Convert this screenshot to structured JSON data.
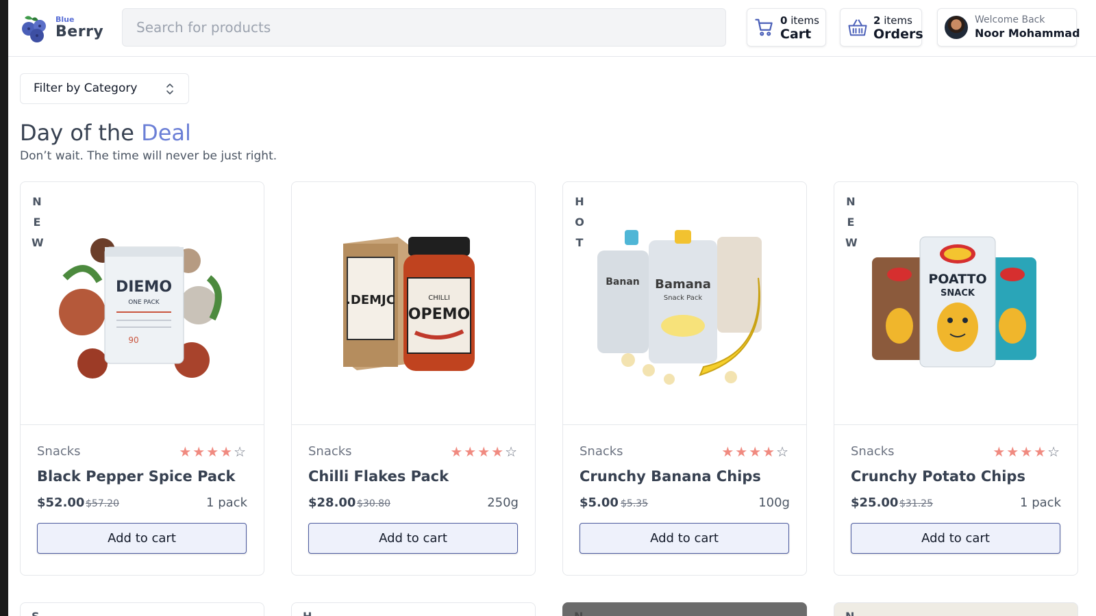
{
  "brand": {
    "small": "Blue",
    "big": "Berry"
  },
  "search": {
    "placeholder": "Search for products"
  },
  "header": {
    "cart": {
      "count": "0",
      "count_suffix": " items",
      "label": "Cart"
    },
    "orders": {
      "count": "2",
      "count_suffix": " items",
      "label": "Orders"
    },
    "user": {
      "greeting": "Welcome Back",
      "name": "Noor Mohammad"
    }
  },
  "filter": {
    "label": "Filter by Category"
  },
  "section": {
    "title_main": "Day of the ",
    "title_accent": "Deal",
    "subtitle": "Don’t wait. The time will never be just right."
  },
  "products": [
    {
      "badge": [
        "N",
        "E",
        "W"
      ],
      "category": "Snacks",
      "name": "Black Pepper Spice Pack",
      "price": "$52.00",
      "old_price": "$57.20",
      "unit": "1 pack",
      "rating": 4,
      "cta": "Add to cart"
    },
    {
      "badge": [],
      "category": "Snacks",
      "name": "Chilli Flakes Pack",
      "price": "$28.00",
      "old_price": "$30.80",
      "unit": "250g",
      "rating": 4,
      "cta": "Add to cart"
    },
    {
      "badge": [
        "H",
        "O",
        "T"
      ],
      "category": "Snacks",
      "name": "Crunchy Banana Chips",
      "price": "$5.00",
      "old_price": "$5.35",
      "unit": "100g",
      "rating": 4,
      "cta": "Add to cart"
    },
    {
      "badge": [
        "N",
        "E",
        "W"
      ],
      "category": "Snacks",
      "name": "Crunchy Potato Chips",
      "price": "$25.00",
      "old_price": "$31.25",
      "unit": "1 pack",
      "rating": 4,
      "cta": "Add to cart"
    }
  ],
  "next_row_peek": [
    "S",
    "H",
    "N",
    "N"
  ],
  "colors": {
    "accent": "#6b7fd6",
    "star": "#f08a80",
    "button_bg": "#eef1fb",
    "button_border": "#4b5a9e"
  }
}
